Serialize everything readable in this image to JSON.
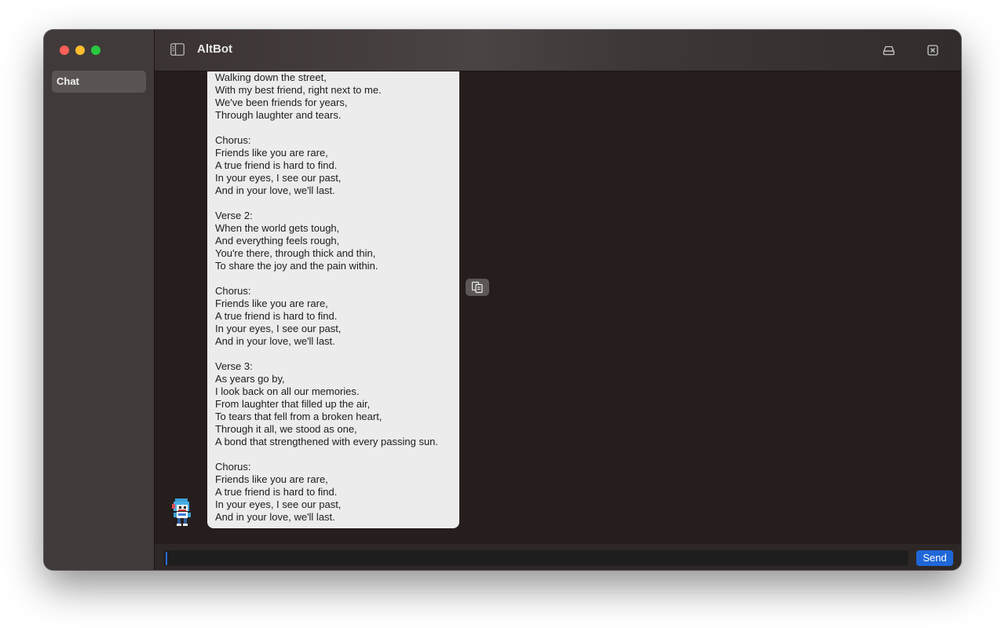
{
  "app": {
    "title": "AltBot"
  },
  "sidebar": {
    "items": [
      {
        "label": "Chat",
        "selected": true
      }
    ]
  },
  "titlebar": {
    "icons": [
      "sidebar-toggle-icon",
      "drive-icon",
      "close-box-icon"
    ]
  },
  "message": {
    "sender": "bot",
    "avatar_icon": "robot-avatar-icon",
    "lines": [
      "Walking down the street,",
      "With my best friend, right next to me.",
      "We've been friends for years,",
      "Through laughter and tears.",
      "",
      "Chorus:",
      "Friends like you are rare,",
      "A true friend is hard to find.",
      "In your eyes, I see our past,",
      "And in your love, we'll last.",
      "",
      "Verse 2:",
      "When the world gets tough,",
      "And everything feels rough,",
      "You're there, through thick and thin,",
      "To share the joy and the pain within.",
      "",
      "Chorus:",
      "Friends like you are rare,",
      "A true friend is hard to find.",
      "In your eyes, I see our past,",
      "And in your love, we'll last.",
      "",
      "Verse 3:",
      "As years go by,",
      "I look back on all our memories.",
      "From laughter that filled up the air,",
      "To tears that fell from a broken heart,",
      "Through it all, we stood as one,",
      "A bond that strengthened with every passing sun.",
      "",
      "Chorus:",
      "Friends like you are rare,",
      "A true friend is hard to find.",
      "In your eyes, I see our past,",
      "And in your love, we'll last."
    ],
    "copy_icon": "copy-icon"
  },
  "input": {
    "value": "",
    "placeholder": "",
    "send_label": "Send"
  },
  "colors": {
    "accent": "#1f67d8",
    "sidebar_bg": "#403b3a",
    "chat_bg": "#251e1d",
    "bubble_bg": "#ececec",
    "traffic_red": "#fe5f57",
    "traffic_yellow": "#febc2e",
    "traffic_green": "#28c840"
  }
}
